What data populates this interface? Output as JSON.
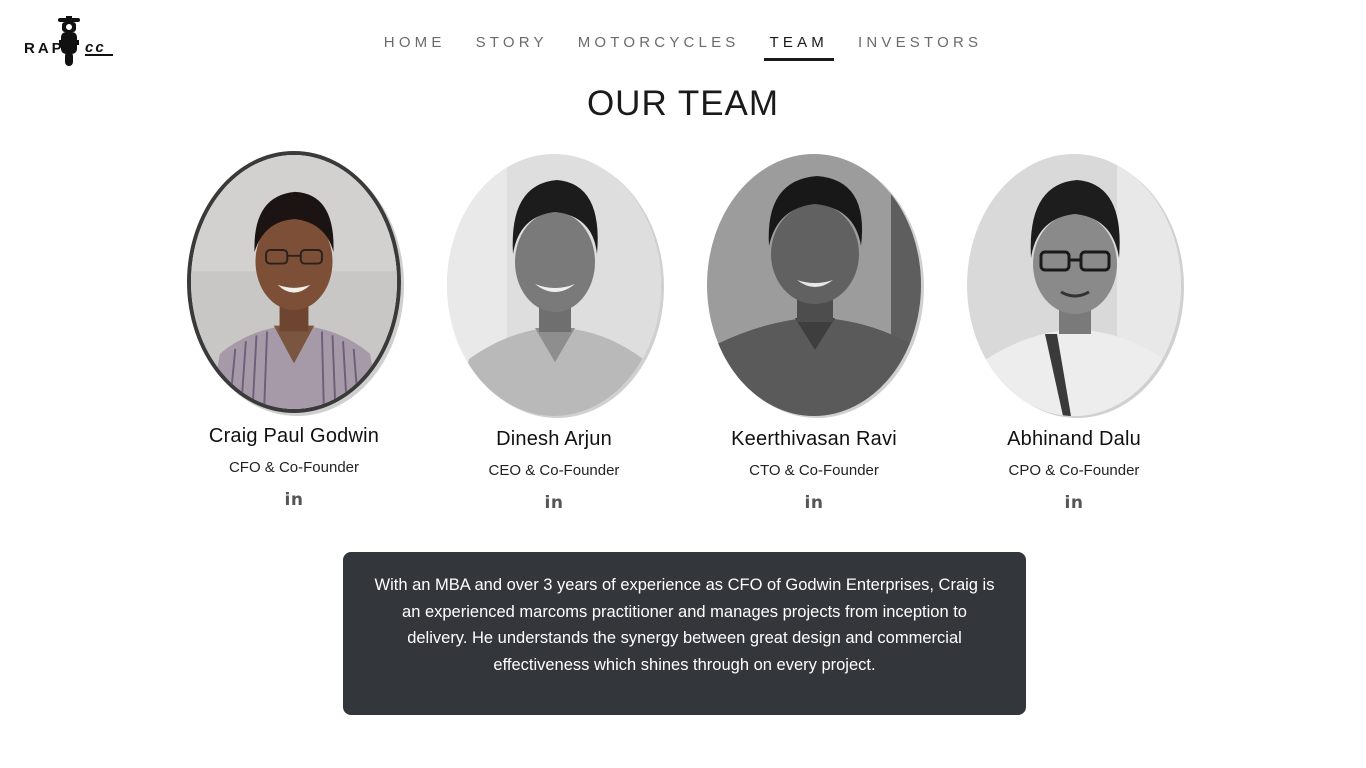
{
  "brand": {
    "logo_left": "RAP",
    "logo_right": "cc"
  },
  "nav": {
    "items": [
      {
        "label": "HOME"
      },
      {
        "label": "STORY"
      },
      {
        "label": "MOTORCYCLES"
      },
      {
        "label": "TEAM"
      },
      {
        "label": "INVESTORS"
      }
    ],
    "active": "TEAM"
  },
  "section": {
    "title": "OUR TEAM"
  },
  "team": {
    "members": [
      {
        "name": "Craig Paul Godwin",
        "role": "CFO & Co-Founder",
        "linkedin": "in",
        "selected": true,
        "photo_style": "color"
      },
      {
        "name": "Dinesh Arjun",
        "role": "CEO & Co-Founder",
        "linkedin": "in",
        "selected": false,
        "photo_style": "grayscale"
      },
      {
        "name": "Keerthivasan Ravi",
        "role": "CTO & Co-Founder",
        "linkedin": "in",
        "selected": false,
        "photo_style": "grayscale"
      },
      {
        "name": "Abhinand Dalu",
        "role": "CPO & Co-Founder",
        "linkedin": "in",
        "selected": false,
        "photo_style": "grayscale"
      }
    ]
  },
  "bio": {
    "text": "With an MBA and over 3 years of experience as CFO of Godwin Enterprises, Craig is an experienced marcoms practitioner and manages projects from inception to delivery. He understands the synergy between great design and commercial effectiveness which shines through on every project."
  },
  "colors": {
    "bio_background": "#33363a",
    "nav_active": "#1a1a1a",
    "nav_inactive": "#6b6b6b",
    "selected_ring": "#3a3a3a"
  }
}
